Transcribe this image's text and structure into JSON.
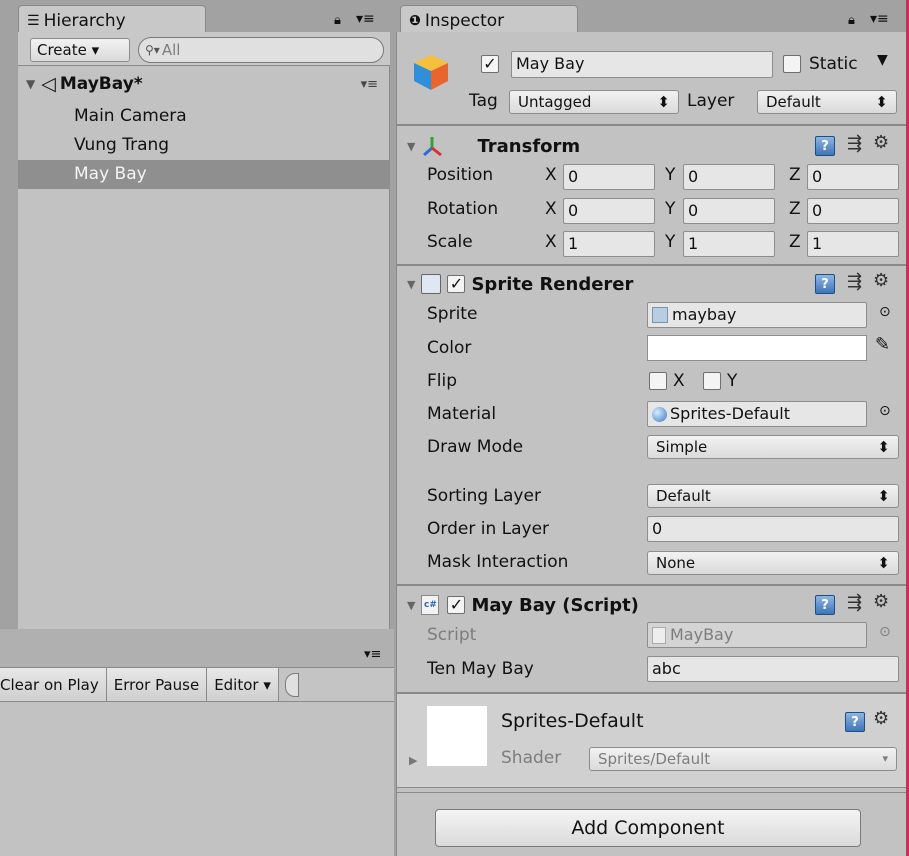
{
  "hierarchy": {
    "tab_label": "Hierarchy",
    "create_label": "Create ▾",
    "search_placeholder": "All",
    "scene_name": "MayBay*",
    "items": [
      "Main Camera",
      "Vung Trang",
      "May Bay"
    ],
    "selected_index": 2
  },
  "console": {
    "clear_on_play": "Clear on Play",
    "error_pause": "Error Pause",
    "editor": "Editor ▾"
  },
  "inspector": {
    "tab_label": "Inspector",
    "object_name": "May Bay",
    "active": true,
    "static_label": "Static",
    "static_checked": false,
    "tag_label": "Tag",
    "tag_value": "Untagged",
    "layer_label": "Layer",
    "layer_value": "Default",
    "transform": {
      "title": "Transform",
      "rows": [
        {
          "label": "Position",
          "x": "0",
          "y": "0",
          "z": "0"
        },
        {
          "label": "Rotation",
          "x": "0",
          "y": "0",
          "z": "0"
        },
        {
          "label": "Scale",
          "x": "1",
          "y": "1",
          "z": "1"
        }
      ],
      "axis_x": "X",
      "axis_y": "Y",
      "axis_z": "Z"
    },
    "sprite_renderer": {
      "title": "Sprite Renderer",
      "enabled": true,
      "sprite_label": "Sprite",
      "sprite_value": "maybay",
      "color_label": "Color",
      "color_value": "#ffffff",
      "flip_label": "Flip",
      "flip_x": "X",
      "flip_y": "Y",
      "material_label": "Material",
      "material_value": "Sprites-Default",
      "draw_mode_label": "Draw Mode",
      "draw_mode_value": "Simple",
      "sorting_layer_label": "Sorting Layer",
      "sorting_layer_value": "Default",
      "order_label": "Order in Layer",
      "order_value": "0",
      "mask_label": "Mask Interaction",
      "mask_value": "None"
    },
    "script": {
      "title": "May Bay (Script)",
      "enabled": true,
      "script_label": "Script",
      "script_value": "MayBay",
      "ten_label": "Ten May Bay",
      "ten_value": "abc"
    },
    "material": {
      "name": "Sprites-Default",
      "shader_label": "Shader",
      "shader_value": "Sprites/Default"
    },
    "add_component": "Add Component"
  },
  "colors": {
    "panel_bg": "#c2c2c2",
    "selection": "#8f8f8f",
    "accent_red": "#c8305a"
  }
}
